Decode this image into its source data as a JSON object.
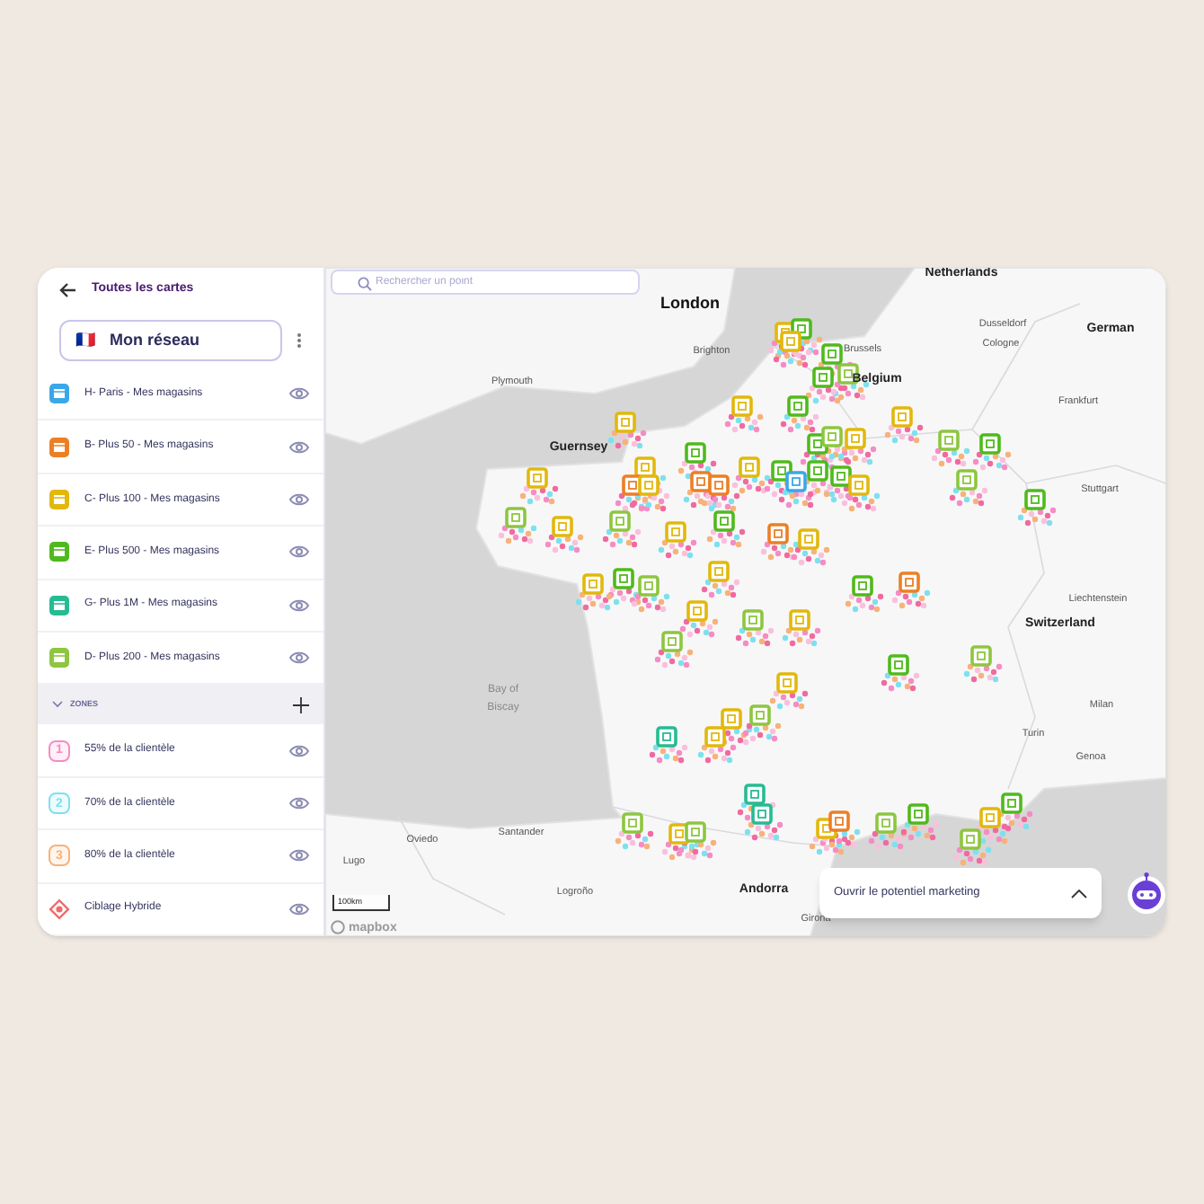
{
  "sidebar": {
    "back_label": "Toutes les cartes",
    "network": {
      "flag": "🇫🇷",
      "label": "Mon réseau"
    },
    "layers": [
      {
        "label": "H- Paris - Mes magasins",
        "color": "#3aa8e8",
        "visible": true
      },
      {
        "label": "B- Plus 50 - Mes magasins",
        "color": "#ec7f26",
        "visible": true
      },
      {
        "label": "C- Plus 100 - Mes magasins",
        "color": "#e2b80c",
        "visible": true
      },
      {
        "label": "E- Plus 500 - Mes magasins",
        "color": "#4fba1c",
        "visible": true
      },
      {
        "label": "G- Plus 1M - Mes magasins",
        "color": "#27bb93",
        "visible": true
      },
      {
        "label": "D- Plus 200 - Mes magasins",
        "color": "#8dc63f",
        "visible": true
      }
    ],
    "zones_header": {
      "label": "ZONES",
      "expanded": true
    },
    "zones": [
      {
        "kind": "numbered",
        "number": "1",
        "label": "55% de la clientèle",
        "color": "#f58cc4",
        "visible": true
      },
      {
        "kind": "numbered",
        "number": "2",
        "label": "70% de la clientèle",
        "color": "#7ee0ee",
        "visible": true
      },
      {
        "kind": "numbered",
        "number": "3",
        "label": "80% de la clientèle",
        "color": "#f6b27a",
        "visible": true
      },
      {
        "kind": "target",
        "label": "Ciblage Hybride",
        "color": "#ef6b6b",
        "visible": true
      }
    ]
  },
  "map": {
    "search": {
      "placeholder": "Rechercher un point"
    },
    "labels": [
      {
        "text": "Netherlands",
        "kind": "country"
      },
      {
        "text": "London",
        "kind": "capital"
      },
      {
        "text": "Dusseldorf",
        "kind": "city"
      },
      {
        "text": "Cologne",
        "kind": "city"
      },
      {
        "text": "German",
        "kind": "country"
      },
      {
        "text": "Brussels",
        "kind": "city"
      },
      {
        "text": "Belgium",
        "kind": "country"
      },
      {
        "text": "Brighton",
        "kind": "city"
      },
      {
        "text": "Plymouth",
        "kind": "city"
      },
      {
        "text": "Frankfurt",
        "kind": "city"
      },
      {
        "text": "Guernsey",
        "kind": "country"
      },
      {
        "text": "Stuttgart",
        "kind": "city"
      },
      {
        "text": "Liechtenstein",
        "kind": "city"
      },
      {
        "text": "Switzerland",
        "kind": "country"
      },
      {
        "text": "Bay of",
        "kind": "sea"
      },
      {
        "text": "Biscay",
        "kind": "sea"
      },
      {
        "text": "Turin",
        "kind": "city"
      },
      {
        "text": "Milan",
        "kind": "city"
      },
      {
        "text": "Genoa",
        "kind": "city"
      },
      {
        "text": "Oviedo",
        "kind": "city"
      },
      {
        "text": "Santander",
        "kind": "city"
      },
      {
        "text": "Lugo",
        "kind": "city"
      },
      {
        "text": "Logroño",
        "kind": "city"
      },
      {
        "text": "Andorra",
        "kind": "country"
      },
      {
        "text": "Girona",
        "kind": "city"
      }
    ],
    "scale": "100km",
    "logo": "mapbox",
    "marketing_panel": {
      "label": "Ouvrir le potentiel marketing",
      "expanded": false
    }
  }
}
